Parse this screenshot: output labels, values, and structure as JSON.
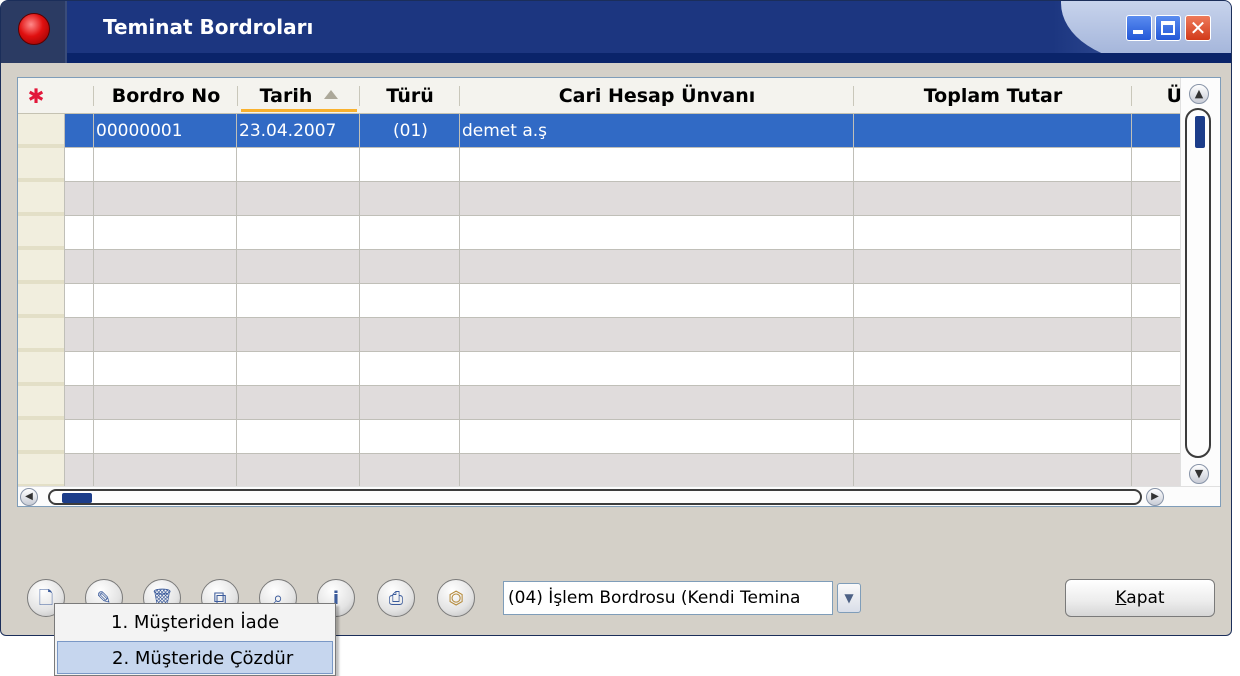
{
  "window": {
    "title": "Teminat Bordroları"
  },
  "grid": {
    "columns": [
      "Bordro No",
      "Tarih",
      "Türü",
      "Cari Hesap Ünvanı",
      "Toplam Tutar",
      "Ü"
    ],
    "rows": [
      {
        "bordro_no": "00000001",
        "tarih": "23.04.2007",
        "turu": "(01)",
        "cari": "demet a.ş",
        "toplam": "",
        "extra": ""
      }
    ],
    "empty_rows": 10,
    "sorted_column": "Tarih",
    "sort_direction": "ascending"
  },
  "toolbar": {
    "buttons": [
      "new-icon",
      "edit-icon",
      "delete-icon",
      "copy-icon",
      "search-icon",
      "info-icon",
      "print-icon",
      "filter-icon"
    ],
    "combo_value": "(04) İşlem Bordrosu (Kendi Temina",
    "close_label": "Kapat"
  },
  "popup_menu": {
    "items": [
      "1. Müşteriden İade",
      "2. Müşteride Çözdür"
    ],
    "highlighted": "2. Müşteride Çözdür"
  },
  "colors": {
    "title_bar": "#0a246a",
    "selection": "#316ac5",
    "alt_row": "#e0dcdc",
    "sort_indicator": "#f9b12e"
  }
}
